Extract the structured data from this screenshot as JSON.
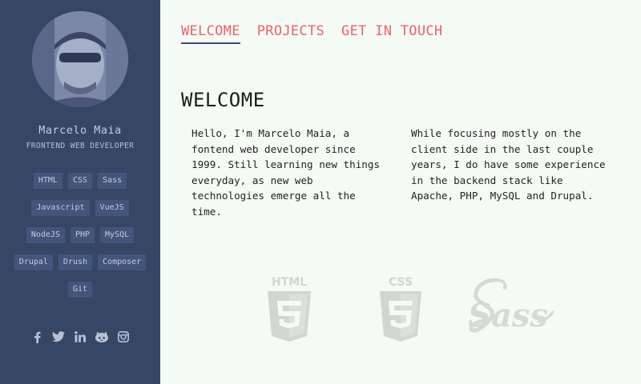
{
  "profile": {
    "name": "Marcelo Maia",
    "role": "FRONTEND WEB DEVELOPER"
  },
  "skills": [
    [
      "HTML",
      "CSS",
      "Sass"
    ],
    [
      "Javascript",
      "VueJS"
    ],
    [
      "NodeJS",
      "PHP",
      "MySQL"
    ],
    [
      "Drupal",
      "Drush",
      "Composer"
    ],
    [
      "Git"
    ]
  ],
  "social_icons": [
    "facebook-icon",
    "twitter-icon",
    "linkedin-icon",
    "github-icon",
    "instagram-icon"
  ],
  "nav": {
    "welcome": "WELCOME",
    "projects": "PROJECTS",
    "contact": "GET IN TOUCH"
  },
  "main": {
    "title": "WELCOME",
    "paragraph_1": "Hello, I'm Marcelo Maia, a\nfontend web developer since\n1999. Still learning new things\neveryday, as new web\ntechnologies emerge all the\ntime.",
    "paragraph_2": "While focusing mostly on the\nclient side in the last couple\nyears, I do have some experience\nin the backend stack like\nApache, PHP, MySQL and Drupal."
  },
  "tech_logos": {
    "html": "HTML",
    "css": "CSS",
    "sass": "Sass"
  },
  "colors": {
    "sidebar": "#364766",
    "tag": "#43557a",
    "accent": "#f0606a",
    "background": "#f4fbf5",
    "logo_gray": "#d4d8d4"
  }
}
